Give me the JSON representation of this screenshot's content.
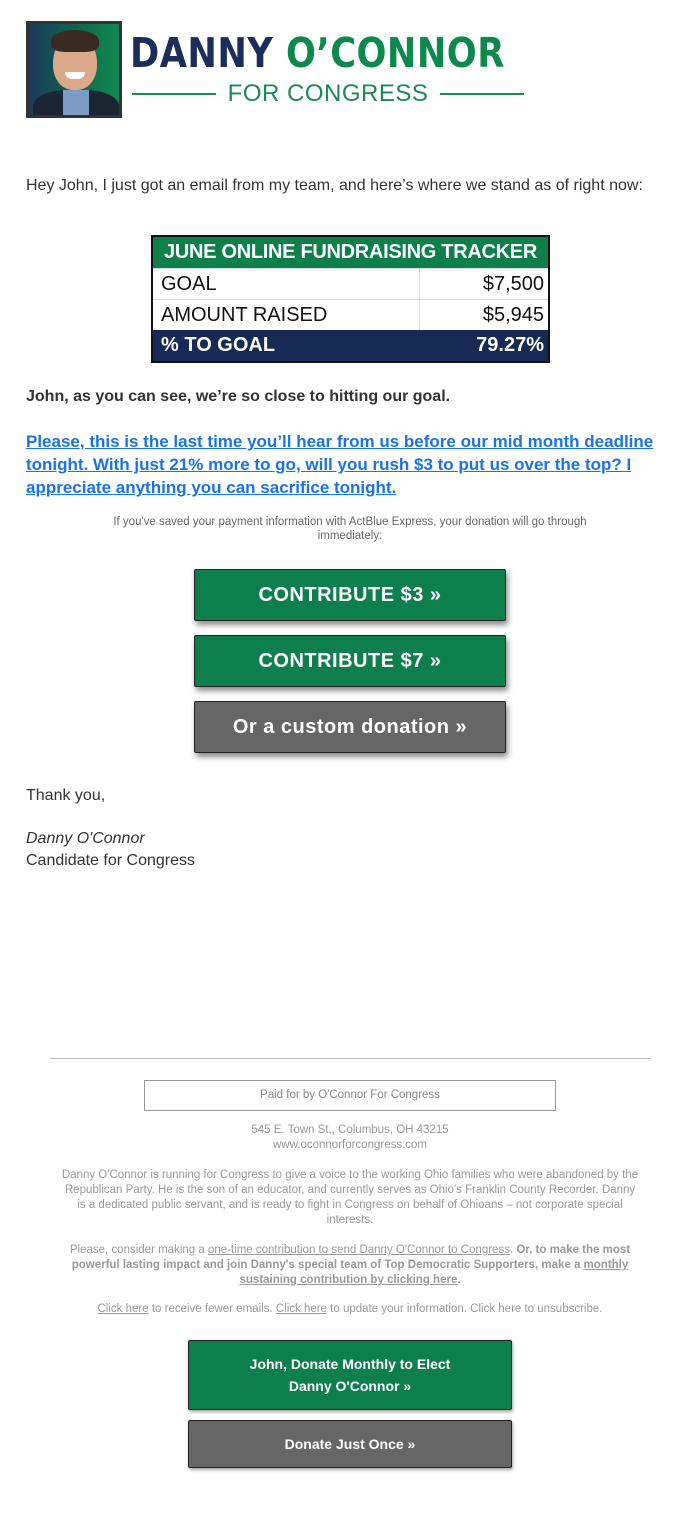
{
  "header": {
    "logo_first": "DANNY",
    "logo_last": "O’CONNOR",
    "logo_sub": "FOR CONGRESS",
    "headshot_alt": "Danny O'Connor headshot"
  },
  "body": {
    "intro": "Hey John, I just got an email from my team, and here’s where we stand as of right now:",
    "tracker": {
      "title": "JUNE ONLINE FUNDRAISING TRACKER",
      "rows": [
        {
          "label": "GOAL",
          "value": "$7,500"
        },
        {
          "label": "AMOUNT RAISED",
          "value": "$5,945"
        }
      ],
      "total": {
        "label": "% TO GOAL",
        "value": "79.27%"
      }
    },
    "close": "John, as you can see, we’re so close to hitting our goal.",
    "ask": "Please, this is the last time you’ll hear from us before our mid month deadline tonight. With just 21% more to go, will you rush $3 to put us over the top? I appreciate anything you can sacrifice tonight.",
    "express_note": "If you've saved your payment information with ActBlue Express, your donation will go through immediately:",
    "buttons": {
      "contribute_3": "CONTRIBUTE $3 »",
      "contribute_7": "CONTRIBUTE $7 »",
      "custom": "Or a custom donation »"
    },
    "thanks": "Thank you,",
    "signature_name": "Danny O'Connor",
    "signature_title": "Candidate for Congress"
  },
  "footer": {
    "paid_for": "Paid for by O'Connor For Congress",
    "address": "545 E. Town St., Columbus, OH 43215",
    "website": "www.oconnorforcongress.com",
    "bio": "Danny O'Connor is running for Congress to give a voice to the working Ohio families who were abandoned by the Republican Party. He is the son of an educator, and currently serves as Ohio's Franklin County Recorder. Danny is a dedicated public servant, and is ready to fight in Congress on behalf of Ohioans – not corporate special interests.",
    "consider_prefix": "Please, consider making a ",
    "one_time_link": "one-time contribution to send Danny O'Connor to Congress",
    "consider_mid": ". ",
    "bold_prefix": "Or, to make the most powerful lasting impact and join Danny's special team of Top Democratic Supporters, make a ",
    "monthly_link": "monthly sustaining contribution by clicking here",
    "bold_suffix": ".",
    "fewer_link": "Click here",
    "fewer_text": " to receive fewer emails. ",
    "update_link": "Click here",
    "update_text": " to update your information. Click here to unsubscribe.",
    "monthly_button_line1": "John, Donate Monthly to Elect",
    "monthly_button_line2": "Danny O'Connor »",
    "once_button": "Donate Just Once »"
  },
  "colors": {
    "brand_green": "#0c7f4c",
    "brand_navy": "#172a55",
    "link_blue": "#1a73e8",
    "button_gray": "#666666"
  }
}
